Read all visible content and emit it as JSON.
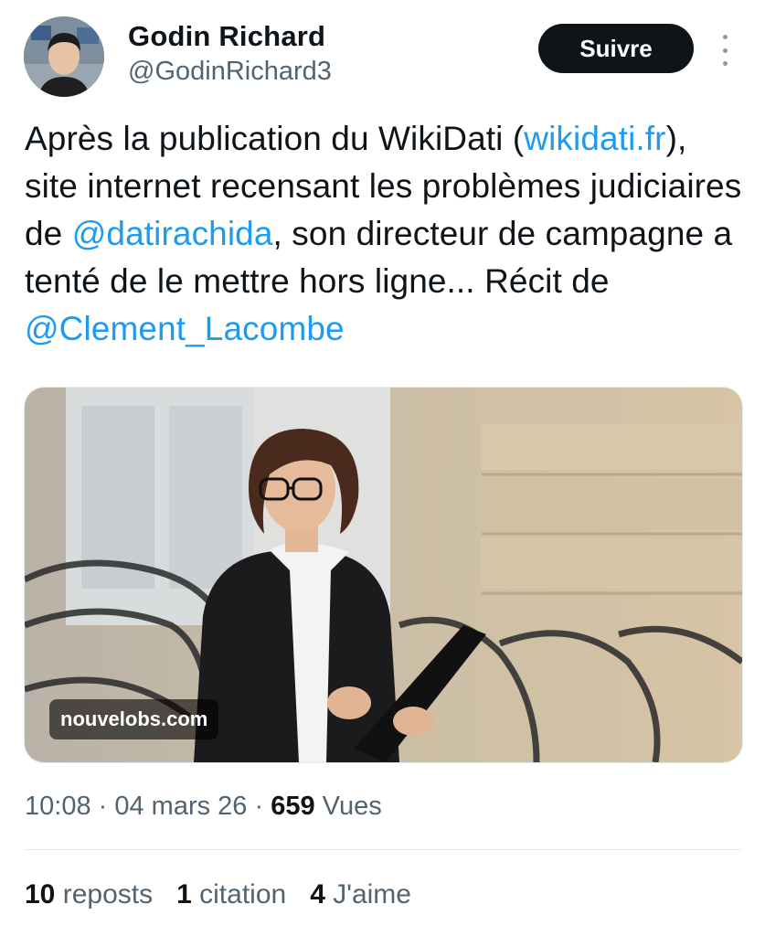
{
  "author": {
    "name": "Godin Richard",
    "handle": "@GodinRichard3"
  },
  "follow_label": "Suivre",
  "tweet": {
    "text_1": "Après la publication du WikiDati (",
    "link_1": "wikidati.fr",
    "text_2": "), site internet recensant les problèmes judiciaires de ",
    "mention_1": "@datirachida",
    "text_3": ", son directeur de campagne a tenté de le mettre hors ligne... Récit de ",
    "mention_2": "@Clement_Lacombe"
  },
  "media": {
    "source": "nouvelobs.com"
  },
  "meta": {
    "time": "10:08",
    "date": "04 mars 26",
    "views_count": "659",
    "views_label": "Vues"
  },
  "stats": {
    "reposts_count": "10",
    "reposts_label": "reposts",
    "quotes_count": "1",
    "quotes_label": "citation",
    "likes_count": "4",
    "likes_label": "J'aime"
  },
  "colors": {
    "link": "#1d9bf0",
    "text": "#0f1419",
    "secondary": "#536471",
    "button_bg": "#0f1419"
  }
}
